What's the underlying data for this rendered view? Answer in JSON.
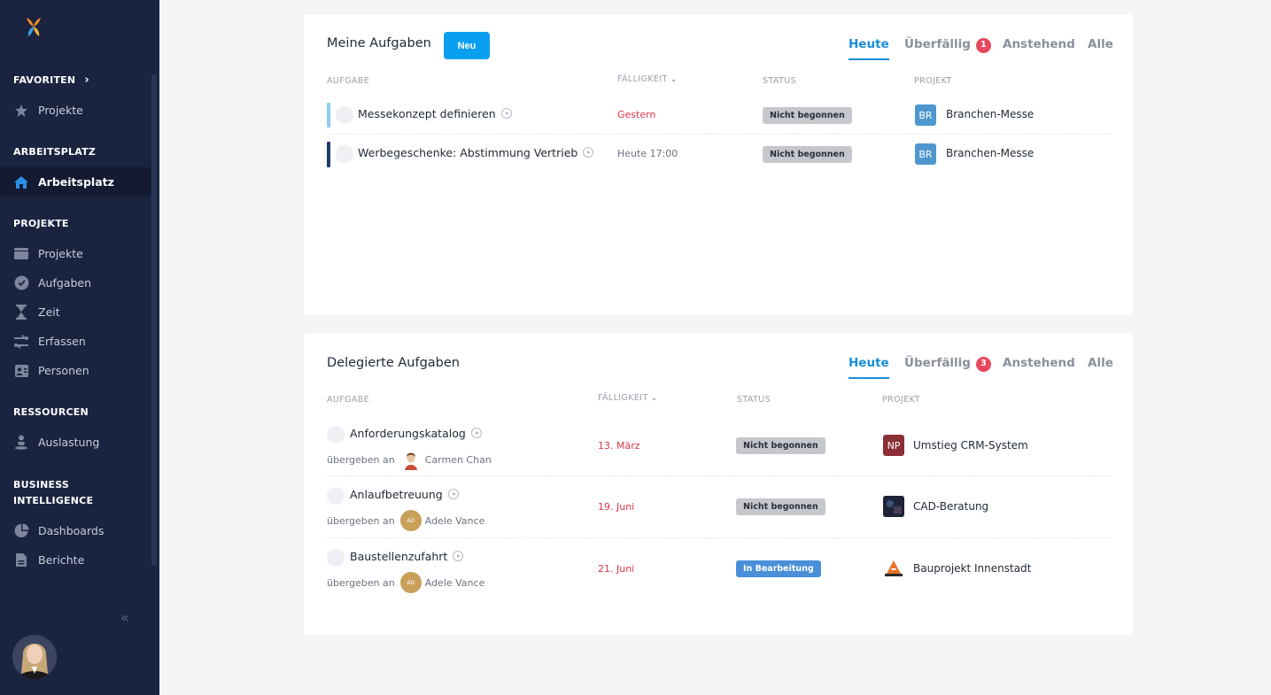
{
  "sidebar": {
    "sections": {
      "favoriten": "FAVORITEN",
      "arbeitsplatz": "ARBEITSPLATZ",
      "projekte": "PROJEKTE",
      "ressourcen": "RESSOURCEN",
      "bi_line1": "BUSINESS",
      "bi_line2": "INTELLIGENCE"
    },
    "items": {
      "fav_projekte": "Projekte",
      "arbeitsplatz": "Arbeitsplatz",
      "projekte": "Projekte",
      "aufgaben": "Aufgaben",
      "zeit": "Zeit",
      "erfassen": "Erfassen",
      "personen": "Personen",
      "auslastung": "Auslastung",
      "dashboards": "Dashboards",
      "berichte": "Berichte"
    },
    "collapse_icon": "«"
  },
  "my_tasks": {
    "title": "Meine Aufgaben",
    "new_button": "Neu",
    "tabs": {
      "heute": "Heute",
      "ueberfaellig": "Überfällig",
      "ueberfaellig_count": "1",
      "anstehend": "Anstehend",
      "alle": "Alle"
    },
    "columns": {
      "aufgabe": "AUFGABE",
      "faelligkeit": "FÄLLIGKEIT",
      "status": "STATUS",
      "projekt": "PROJEKT"
    },
    "rows": [
      {
        "name": "Messekonzept definieren",
        "due": "Gestern",
        "status": "Nicht begonnen",
        "project_abbr": "BR",
        "project": "Branchen-Messe",
        "bar_color": "#8ecbf2"
      },
      {
        "name": "Werbegeschenke: Abstimmung Vertrieb",
        "due": "Heute 17:00",
        "status": "Nicht begonnen",
        "project_abbr": "BR",
        "project": "Branchen-Messe",
        "bar_color": "#1f3c6b"
      }
    ]
  },
  "delegated_tasks": {
    "title": "Delegierte Aufgaben",
    "tabs": {
      "heute": "Heute",
      "ueberfaellig": "Überfällig",
      "ueberfaellig_count": "3",
      "anstehend": "Anstehend",
      "alle": "Alle"
    },
    "columns": {
      "aufgabe": "AUFGABE",
      "faelligkeit": "FÄLLIGKEIT",
      "status": "STATUS",
      "projekt": "PROJEKT"
    },
    "delegated_prefix": "übergeben an",
    "rows": [
      {
        "name": "Anforderungskatalog",
        "assignee": "Carmen Chan",
        "assignee_initials": "",
        "due": "13. März",
        "status": "Nicht begonnen",
        "project_abbr": "NP",
        "project": "Umstieg CRM-System"
      },
      {
        "name": "Anlaufbetreuung",
        "assignee": "Adele Vance",
        "assignee_initials": "AD",
        "due": "19. Juni",
        "status": "Nicht begonnen",
        "project_abbr": "",
        "project": "CAD-Beratung"
      },
      {
        "name": "Baustellenzufahrt",
        "assignee": "Adele Vance",
        "assignee_initials": "AD",
        "due": "21. Juni",
        "status": "In Bearbeitung",
        "project_abbr": "",
        "project": "Bauprojekt Innenstadt"
      }
    ]
  },
  "colors": {
    "sidebar_bg": "#1a2340",
    "accent": "#0aa0ef",
    "tab_active": "#1a8ed8",
    "badge": "#e5485d",
    "due_red": "#d9364a"
  }
}
